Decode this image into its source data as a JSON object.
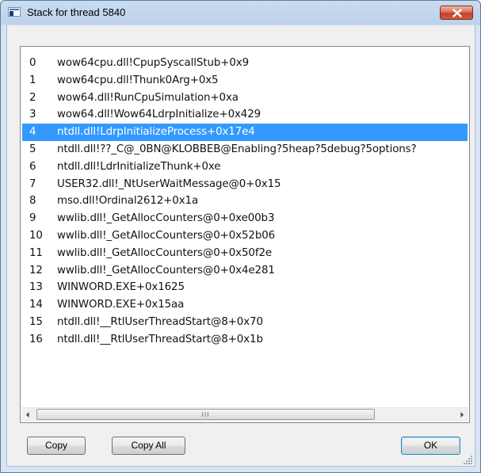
{
  "window": {
    "title": "Stack for thread 5840"
  },
  "stack": {
    "selected_index": 4,
    "frames": [
      {
        "index": "0",
        "frame": "wow64cpu.dll!CpupSyscallStub+0x9"
      },
      {
        "index": "1",
        "frame": "wow64cpu.dll!Thunk0Arg+0x5"
      },
      {
        "index": "2",
        "frame": "wow64.dll!RunCpuSimulation+0xa"
      },
      {
        "index": "3",
        "frame": "wow64.dll!Wow64LdrpInitialize+0x429"
      },
      {
        "index": "4",
        "frame": "ntdll.dll!LdrpInitializeProcess+0x17e4"
      },
      {
        "index": "5",
        "frame": "ntdll.dll!??_C@_0BN@KLOBBEB@Enabling?5heap?5debug?5options?"
      },
      {
        "index": "6",
        "frame": "ntdll.dll!LdrInitializeThunk+0xe"
      },
      {
        "index": "7",
        "frame": "USER32.dll!_NtUserWaitMessage@0+0x15"
      },
      {
        "index": "8",
        "frame": "mso.dll!Ordinal2612+0x1a"
      },
      {
        "index": "9",
        "frame": "wwlib.dll!_GetAllocCounters@0+0xe00b3"
      },
      {
        "index": "10",
        "frame": "wwlib.dll!_GetAllocCounters@0+0x52b06"
      },
      {
        "index": "11",
        "frame": "wwlib.dll!_GetAllocCounters@0+0x50f2e"
      },
      {
        "index": "12",
        "frame": "wwlib.dll!_GetAllocCounters@0+0x4e281"
      },
      {
        "index": "13",
        "frame": "WINWORD.EXE+0x1625"
      },
      {
        "index": "14",
        "frame": "WINWORD.EXE+0x15aa"
      },
      {
        "index": "15",
        "frame": "ntdll.dll!__RtlUserThreadStart@8+0x70"
      },
      {
        "index": "16",
        "frame": "ntdll.dll!__RtlUserThreadStart@8+0x1b"
      }
    ]
  },
  "scrollbar": {
    "grip": "III"
  },
  "buttons": {
    "copy": "Copy",
    "copy_all": "Copy All",
    "ok": "OK"
  },
  "colors": {
    "selection": "#3399ff",
    "close_button": "#c2412a",
    "titlebar": "#c9dcf0"
  }
}
